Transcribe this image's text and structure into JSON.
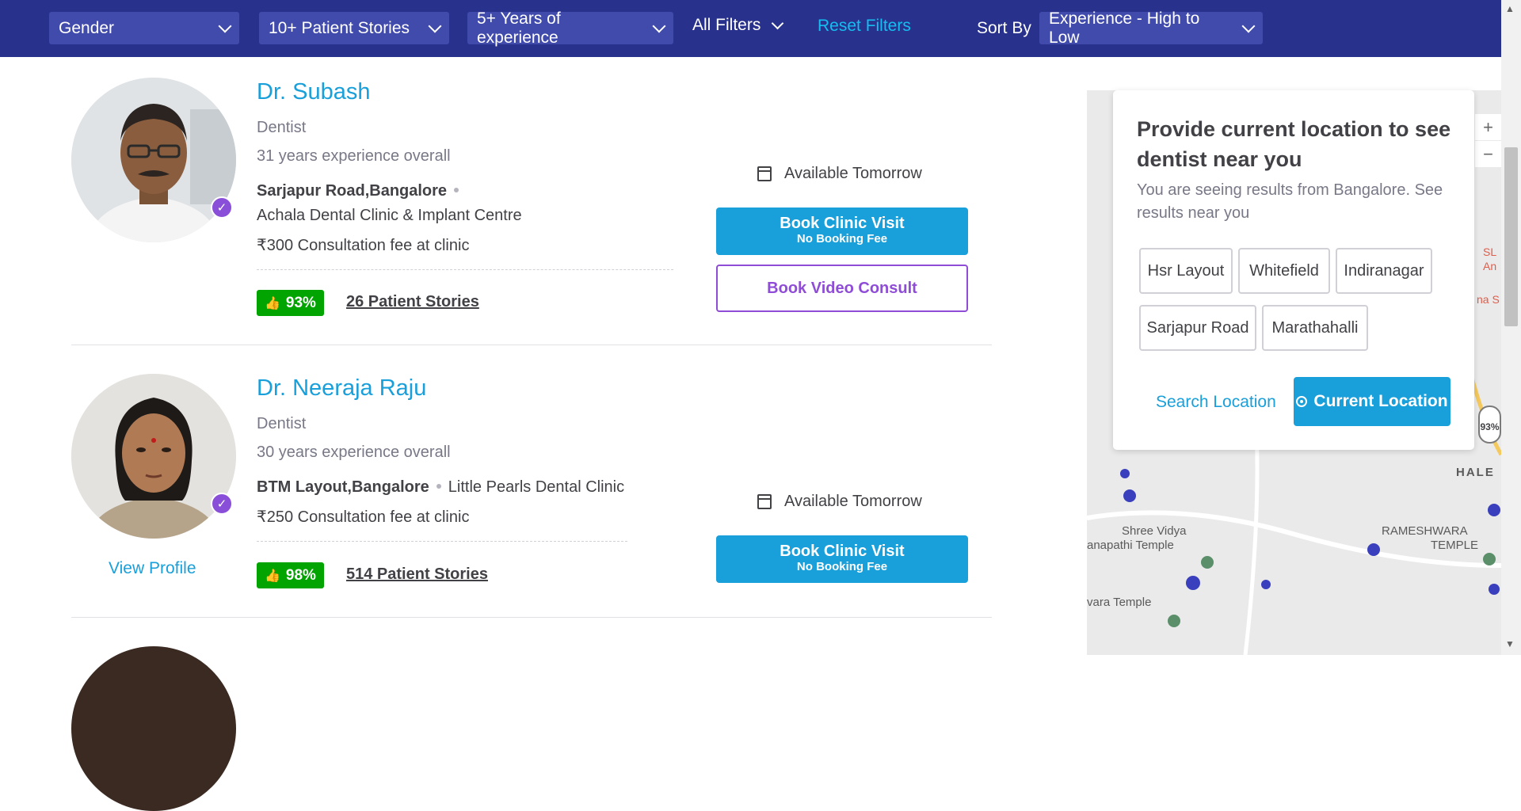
{
  "filters": {
    "gender": "Gender",
    "stories": "10+ Patient Stories",
    "experience": "5+ Years of experience",
    "all_filters": "All Filters",
    "reset": "Reset Filters",
    "sort_label": "Sort By",
    "sort_value": "Experience - High to Low"
  },
  "doctors": [
    {
      "name": "Dr. Subash",
      "specialty": "Dentist",
      "experience": "31 years experience overall",
      "area": "Sarjapur Road,Bangalore",
      "clinic": "Achala Dental Clinic & Implant Centre",
      "fee": "₹300 Consultation fee at clinic",
      "rating": "93%",
      "stories": "26 Patient Stories",
      "availability": "Available Tomorrow",
      "clinic_button": "Book Clinic Visit",
      "clinic_button_sub": "No Booking Fee",
      "video_button": "Book Video Consult"
    },
    {
      "name": "Dr. Neeraja Raju",
      "specialty": "Dentist",
      "experience": "30 years experience overall",
      "area": "BTM Layout,Bangalore",
      "clinic": "Little Pearls Dental Clinic",
      "fee": "₹250 Consultation fee at clinic",
      "rating": "98%",
      "stories": "514 Patient Stories",
      "availability": "Available Tomorrow",
      "clinic_button": "Book Clinic Visit",
      "clinic_button_sub": "No Booking Fee",
      "view_profile": "View Profile"
    }
  ],
  "location_panel": {
    "title": "Provide current location to see dentist near you",
    "subtitle": "You are seeing results from Bangalore. See results near you",
    "chips": [
      "Hsr Layout",
      "Whitefield",
      "Indiranagar",
      "Sarjapur Road",
      "Marathahalli"
    ],
    "search_location": "Search Location",
    "current_location": "Current Location"
  },
  "map": {
    "labels": [
      "Shree Vidya",
      "anapathi Temple",
      "RAMESHWARA",
      "TEMPLE",
      "HALE",
      "vara Temple",
      "SL",
      "An",
      "na S",
      "93%"
    ],
    "zoom_in": "+",
    "zoom_out": "−"
  },
  "colors": {
    "header_bg": "#28328c",
    "filter_bg": "#414bac",
    "brand_blue": "#199fd9",
    "reset_blue": "#14bef0",
    "rating_green": "#01a400",
    "video_purple": "#8f4cd6"
  }
}
